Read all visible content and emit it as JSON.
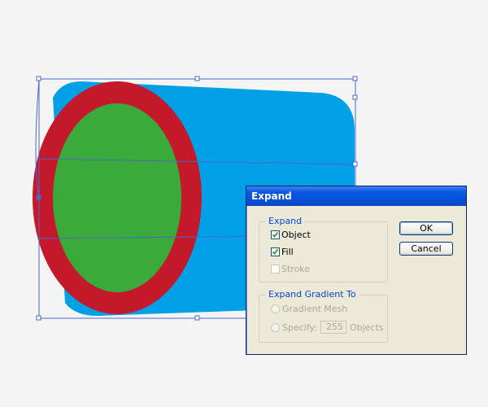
{
  "dialog": {
    "title": "Expand",
    "expand_group": {
      "legend": "Expand",
      "object_label": "Object",
      "object_checked": true,
      "fill_label": "Fill",
      "fill_checked": true,
      "stroke_label": "Stroke",
      "stroke_checked": false,
      "stroke_disabled": true
    },
    "gradient_group": {
      "legend": "Expand Gradient To",
      "gradient_mesh_label": "Gradient Mesh",
      "specify_label": "Specify:",
      "specify_value": "255",
      "objects_label": "Objects"
    },
    "ok_label": "OK",
    "cancel_label": "Cancel"
  },
  "artwork": {
    "colors": {
      "body": "#00a0e6",
      "ring": "#c4182b",
      "inner": "#3aaa3a",
      "selection": "#4a68c8"
    }
  }
}
